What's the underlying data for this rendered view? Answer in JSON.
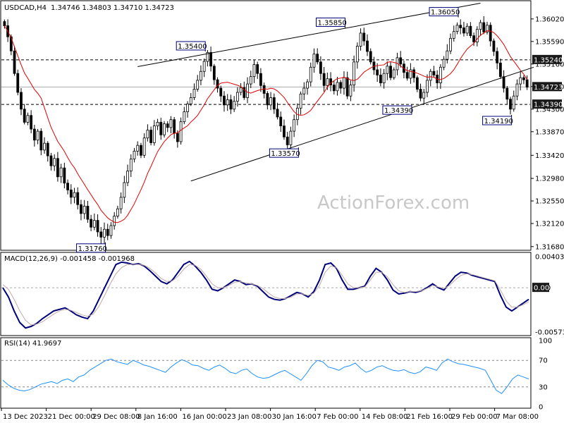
{
  "chart_data": [
    {
      "type": "candlestick",
      "symbol": "USDCAD,H4",
      "header_values": "1.34746 1.34803 1.34710 1.34723",
      "watermark": "ActionForex.com",
      "ylim": [
        1.3165,
        1.363
      ],
      "y_ticks": [
        "1.36020",
        "1.35590",
        "1.35160",
        "1.34730",
        "1.34300",
        "1.33870",
        "1.33420",
        "1.32980",
        "1.32550",
        "1.32120",
        "1.31680"
      ],
      "y_tick_values": [
        1.3602,
        1.3559,
        1.3516,
        1.3473,
        1.343,
        1.3387,
        1.3342,
        1.3298,
        1.3255,
        1.3212,
        1.3168
      ],
      "price_badges": [
        {
          "text": "1.35240",
          "value": 1.3524,
          "style": "dark"
        },
        {
          "text": "1.34723",
          "value": 1.34723,
          "style": "dark"
        },
        {
          "text": "1.34390",
          "value": 1.3439,
          "style": "dark"
        }
      ],
      "horizontal_lines": [
        1.3524,
        1.3439
      ],
      "current_price": 1.34723,
      "swing_labels": [
        {
          "text": "1.35400",
          "value": 1.354,
          "date": "17 Jan"
        },
        {
          "text": "1.35850",
          "value": 1.3585,
          "date": "1 Feb"
        },
        {
          "text": "1.36050",
          "value": 1.3605,
          "date": "26 Feb"
        },
        {
          "text": "1.33570",
          "value": 1.3357,
          "date": "31 Jan"
        },
        {
          "text": "1.34390",
          "value": 1.3439,
          "date": "19 Feb"
        },
        {
          "text": "1.34190",
          "value": 1.3419,
          "date": "7 Mar"
        },
        {
          "text": "1.31760",
          "value": 1.3176,
          "date": "27 Dec"
        }
      ],
      "trendlines": [
        {
          "from": {
            "date": "30 Dec",
            "value": 1.3511
          },
          "to": {
            "date": "2 Mar",
            "value": 1.3632
          }
        },
        {
          "from": {
            "date": "10 Jan",
            "value": 1.3293
          },
          "to": {
            "date": "10 Mar",
            "value": 1.351
          }
        }
      ],
      "candles_close": [
        1.3589,
        1.3568,
        1.3541,
        1.3498,
        1.3462,
        1.343,
        1.3405,
        1.3418,
        1.3392,
        1.3371,
        1.3388,
        1.3352,
        1.3365,
        1.3341,
        1.3322,
        1.3336,
        1.3301,
        1.3318,
        1.3289,
        1.3276,
        1.3262,
        1.3271,
        1.3248,
        1.3231,
        1.3245,
        1.322,
        1.3205,
        1.3218,
        1.3196,
        1.3186,
        1.3201,
        1.3189,
        1.3208,
        1.3226,
        1.324,
        1.3262,
        1.329,
        1.3312,
        1.3335,
        1.335,
        1.3361,
        1.3342,
        1.3375,
        1.339,
        1.3366,
        1.3398,
        1.3405,
        1.3381,
        1.3402,
        1.3395,
        1.341,
        1.3384,
        1.3368,
        1.3406,
        1.3425,
        1.344,
        1.3452,
        1.3468,
        1.3485,
        1.3502,
        1.3521,
        1.3538,
        1.3512,
        1.3486,
        1.347,
        1.3455,
        1.3438,
        1.3448,
        1.343,
        1.3445,
        1.3462,
        1.3471,
        1.3452,
        1.3478,
        1.3492,
        1.3515,
        1.3498,
        1.3475,
        1.346,
        1.3438,
        1.3452,
        1.343,
        1.3415,
        1.3398,
        1.3377,
        1.3362,
        1.3388,
        1.341,
        1.3432,
        1.3459,
        1.347,
        1.3482,
        1.351,
        1.3535,
        1.352,
        1.3498,
        1.3475,
        1.3488,
        1.3476,
        1.3465,
        1.3481,
        1.347,
        1.349,
        1.3455,
        1.3476,
        1.352,
        1.355,
        1.3575,
        1.356,
        1.354,
        1.352,
        1.3505,
        1.3495,
        1.348,
        1.3498,
        1.3512,
        1.349,
        1.3505,
        1.3528,
        1.3516,
        1.35,
        1.3489,
        1.3505,
        1.349,
        1.3468,
        1.3451,
        1.3462,
        1.3485,
        1.3502,
        1.3495,
        1.348,
        1.351,
        1.3525,
        1.3541,
        1.3565,
        1.3578,
        1.359,
        1.3585,
        1.3575,
        1.3588,
        1.357,
        1.3558,
        1.3582,
        1.3595,
        1.3577,
        1.359,
        1.356,
        1.354,
        1.3518,
        1.3492,
        1.347,
        1.3449,
        1.343,
        1.3455,
        1.3478,
        1.349,
        1.3486,
        1.3472
      ],
      "sma_color": "#e00000",
      "tick_dates": [
        "13 Dec 2023",
        "21 Dec 00:00",
        "29 Dec 08:00",
        "8 Jan 16:00",
        "16 Jan 00:00",
        "23 Jan 08:00",
        "30 Jan 16:00",
        "7 Feb 00:00",
        "14 Feb 08:00",
        "21 Feb 16:00",
        "29 Feb 00:00",
        "7 Mar 08:00"
      ]
    },
    {
      "type": "line",
      "title": "MACD(12,26,9) -0.001458 -0.001968",
      "ylim": [
        -0.006,
        0.0042
      ],
      "y_ticks": [
        "0.004038",
        "0.00",
        "-0.005737"
      ],
      "y_tick_values": [
        0.004038,
        0.0,
        -0.005737
      ],
      "badge": {
        "text": "0.00",
        "style": "dark"
      },
      "series": [
        {
          "role": "macd",
          "color": "#00007a",
          "values": [
            -0.0,
            -0.0012,
            -0.003,
            -0.0045,
            -0.0052,
            -0.005,
            -0.0046,
            -0.004,
            -0.0035,
            -0.003,
            -0.0028,
            -0.0026,
            -0.003,
            -0.0035,
            -0.0038,
            -0.004,
            -0.003,
            -0.0015,
            0.0,
            0.0015,
            0.003,
            0.0033,
            0.0032,
            0.003,
            0.0031,
            0.0028,
            0.0022,
            0.0015,
            0.0008,
            0.0005,
            0.001,
            0.002,
            0.003,
            0.0034,
            0.0028,
            0.002,
            0.001,
            -0.0002,
            -0.0004,
            0.0,
            0.0005,
            0.001,
            0.0008,
            0.0004,
            0.0005,
            0.0002,
            -0.0005,
            -0.0012,
            -0.0015,
            -0.0016,
            -0.0014,
            -0.001,
            -0.0006,
            -0.0008,
            -0.0012,
            -0.0005,
            0.001,
            0.003,
            0.0032,
            0.0025,
            0.001,
            -0.0002,
            -0.0002,
            0.0,
            0.0002,
            0.0015,
            0.0025,
            0.002,
            0.001,
            -0.0003,
            -0.0008,
            -0.0007,
            -0.0005,
            -0.0006,
            -0.0004,
            0.0,
            0.0005,
            0.0,
            -0.0003,
            0.0006,
            0.0015,
            0.002,
            0.0019,
            0.0016,
            0.0014,
            0.0012,
            0.001,
            0.0008,
            -0.001,
            -0.0025,
            -0.003,
            -0.0025,
            -0.002,
            -0.0015
          ]
        },
        {
          "role": "signal",
          "color": "#bfa9a9",
          "values": [
            0.0004,
            -0.0002,
            -0.0015,
            -0.003,
            -0.0042,
            -0.0048,
            -0.0047,
            -0.0044,
            -0.0039,
            -0.0034,
            -0.003,
            -0.0028,
            -0.0029,
            -0.0032,
            -0.0035,
            -0.0037,
            -0.0034,
            -0.0024,
            -0.001,
            0.0005,
            0.0018,
            0.0026,
            0.003,
            0.003,
            0.003,
            0.0029,
            0.0025,
            0.0019,
            0.0012,
            0.0008,
            0.0009,
            0.0015,
            0.0024,
            0.003,
            0.0029,
            0.0024,
            0.0015,
            0.0005,
            0.0,
            0.0,
            0.0003,
            0.0007,
            0.0008,
            0.0006,
            0.0005,
            0.0003,
            -0.0001,
            -0.0007,
            -0.0012,
            -0.0014,
            -0.0014,
            -0.0012,
            -0.0008,
            -0.0008,
            -0.001,
            -0.0007,
            0.0003,
            0.002,
            0.0028,
            0.0026,
            0.0016,
            0.0005,
            0.0,
            0.0,
            0.0001,
            0.001,
            0.002,
            0.002,
            0.0014,
            0.0004,
            -0.0004,
            -0.0006,
            -0.0005,
            -0.0005,
            -0.0004,
            -0.0001,
            0.0003,
            0.0001,
            -0.0001,
            0.0003,
            0.001,
            0.0016,
            0.0018,
            0.0017,
            0.0015,
            0.0013,
            0.0011,
            0.0009,
            -0.0003,
            -0.0017,
            -0.0025,
            -0.0025,
            -0.0022,
            -0.0018
          ]
        }
      ]
    },
    {
      "type": "line",
      "title": "RSI(14) 41.9697",
      "ylim": [
        0,
        100
      ],
      "y_ticks": [
        "100",
        "70",
        "30",
        "0"
      ],
      "y_tick_values": [
        100,
        70,
        30,
        0
      ],
      "levels": [
        70,
        30
      ],
      "series": [
        {
          "role": "rsi",
          "color": "#1e90ff",
          "values": [
            40,
            33,
            28,
            25,
            24,
            26,
            30,
            34,
            36,
            38,
            35,
            40,
            42,
            38,
            45,
            48,
            55,
            60,
            65,
            70,
            72,
            68,
            66,
            64,
            70,
            67,
            63,
            61,
            58,
            55,
            52,
            60,
            66,
            71,
            68,
            63,
            62,
            58,
            55,
            60,
            63,
            58,
            52,
            50,
            55,
            57,
            50,
            45,
            43,
            44,
            48,
            52,
            55,
            50,
            45,
            40,
            50,
            62,
            70,
            68,
            60,
            58,
            55,
            60,
            62,
            66,
            58,
            52,
            55,
            60,
            62,
            58,
            55,
            54,
            56,
            52,
            50,
            53,
            60,
            58,
            55,
            66,
            72,
            68,
            65,
            64,
            62,
            60,
            58,
            55,
            40,
            25,
            20,
            30,
            42,
            48,
            45,
            42
          ]
        }
      ]
    }
  ]
}
